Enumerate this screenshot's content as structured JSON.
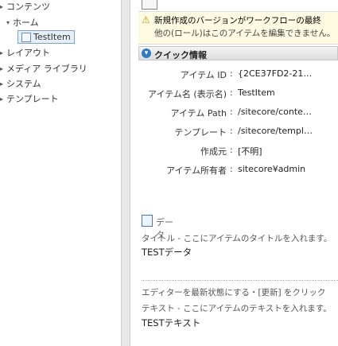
{
  "tree": {
    "items": [
      {
        "label": "コンテンツ",
        "arrow": "▸"
      },
      {
        "label": "ホーム",
        "arrow": "▾"
      },
      {
        "label": "TestItem",
        "selected": true
      },
      {
        "label": "レイアウト",
        "arrow": "▸"
      },
      {
        "label": "メディア ライブラリ",
        "arrow": "▸"
      },
      {
        "label": "システム",
        "arrow": "▸"
      },
      {
        "label": "テンプレート",
        "arrow": "▸"
      }
    ]
  },
  "warning": {
    "icon": "warning-icon",
    "line1": "新規作成のバージョンがワークフローの最終",
    "line2": "他の(ロール)はこのアイテムを編集できません。"
  },
  "quick_info": {
    "title": "クイック情報",
    "rows": [
      {
        "label": "アイテム ID",
        "value": "{2CE37FD2-21…"
      },
      {
        "label": "アイテム名 (表示名)",
        "value": "TestItem"
      },
      {
        "label": "アイテム Path",
        "value": "/sitecore/conte…"
      },
      {
        "label": "テンプレート",
        "value": "/sitecore/templ…"
      },
      {
        "label": "作成元",
        "value": "[不明]"
      },
      {
        "label": "アイテム所有者",
        "value": "sitecore¥admin"
      }
    ]
  },
  "data_section": {
    "title": "データ"
  },
  "fields": [
    {
      "label": "タイトル - ここにアイテムのタイトルを入れます。",
      "value": "TESTデータ"
    },
    {
      "label": "テキスト - ここにアイテムのテキストを入れます。",
      "value": "TESTテキスト"
    }
  ],
  "shared_note": "エディターを最新状態にする・[更新] をクリック"
}
